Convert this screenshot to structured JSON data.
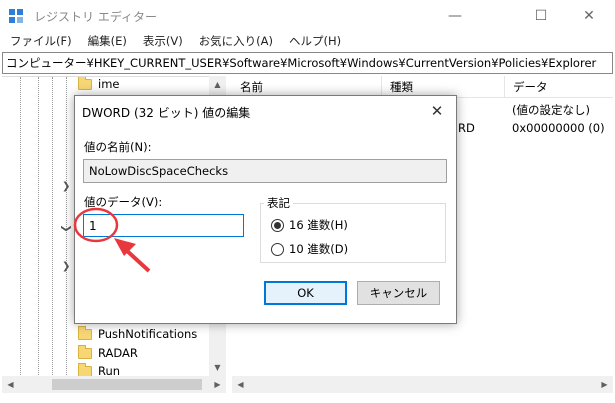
{
  "window": {
    "title": "レジストリ エディター",
    "min_glyph": "—",
    "max_glyph": "☐",
    "close_glyph": "✕"
  },
  "menu": [
    "ファイル(F)",
    "編集(E)",
    "表示(V)",
    "お気に入り(A)",
    "ヘルプ(H)"
  ],
  "address": "コンピューター¥HKEY_CURRENT_USER¥Software¥Microsoft¥Windows¥CurrentVersion¥Policies¥Explorer",
  "tree": {
    "items": [
      "ime",
      "PushNotifications",
      "RADAR",
      "Run"
    ],
    "expander_glyph": "❯"
  },
  "list": {
    "columns": [
      "名前",
      "種類",
      "データ"
    ],
    "rows": [
      {
        "type": "",
        "data": "(値の設定なし)"
      },
      {
        "type": "RD",
        "data": "0x00000000 (0)"
      }
    ]
  },
  "dialog": {
    "title": "DWORD (32 ビット) 値の編集",
    "close_glyph": "✕",
    "name_label": "値の名前(N):",
    "name_value": "NoLowDiscSpaceChecks",
    "data_label": "値のデータ(V):",
    "data_value": "1",
    "base_label": "表記",
    "hex_label": "16 進数(H)",
    "dec_label": "10 進数(D)",
    "hex_selected": true,
    "ok_label": "OK",
    "cancel_label": "キャンセル"
  },
  "colors": {
    "accent": "#0078d7",
    "annotation": "#e8383d",
    "folder": "#f7d674"
  },
  "icons": {
    "app": "regedit-icon",
    "folder": "folder-icon",
    "expander": "chevron-right-icon"
  }
}
